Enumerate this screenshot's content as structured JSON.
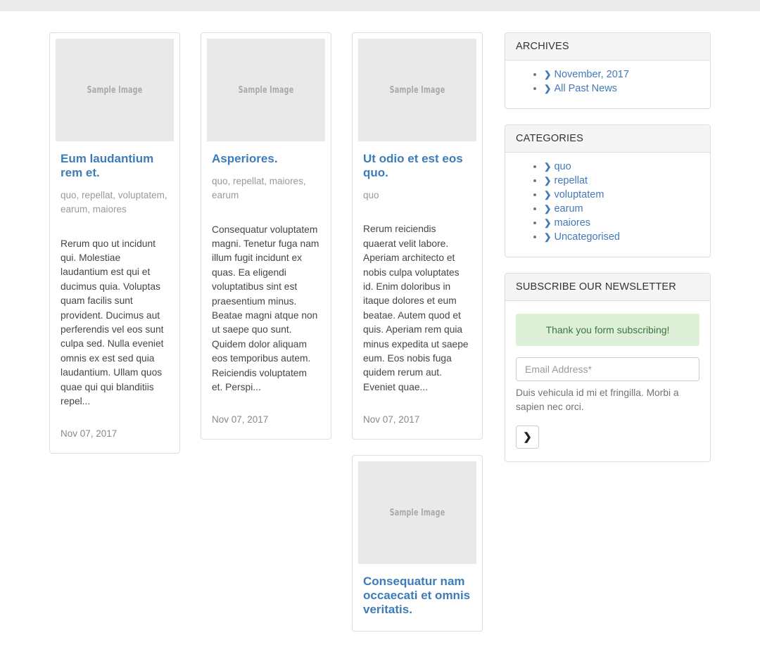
{
  "topbar": {
    "present": true
  },
  "posts": {
    "image_placeholder_label": "Sample Image",
    "columns": [
      {
        "cards": [
          {
            "title": "Eum laudantium rem et.",
            "tags": "quo, repellat, voluptatem, earum, maiores",
            "excerpt": "Rerum quo ut incidunt qui. Molestiae laudantium est qui et ducimus quia. Voluptas quam facilis sunt provident. Ducimus aut perferendis vel eos sunt culpa sed. Nulla eveniet omnis ex est sed quia laudantium. Ullam quos quae qui qui blanditiis repel...",
            "date": "Nov 07, 2017"
          }
        ]
      },
      {
        "cards": [
          {
            "title": "Asperiores.",
            "tags": "quo, repellat, maiores, earum",
            "excerpt": "Consequatur voluptatem magni. Tenetur fuga nam illum fugit incidunt ex quas. Ea eligendi voluptatibus sint est praesentium minus. Beatae magni atque non ut saepe quo sunt. Quidem dolor aliquam eos temporibus autem. Reiciendis voluptatem et. Perspi...",
            "date": "Nov 07, 2017"
          }
        ]
      },
      {
        "cards": [
          {
            "title": "Ut odio et est eos quo.",
            "tags": "quo",
            "excerpt": "Rerum reiciendis quaerat velit labore. Aperiam architecto et nobis culpa voluptates id. Enim doloribus in itaque dolores et eum beatae. Autem quod et quis. Aperiam rem quia minus expedita ut saepe eum. Eos nobis fuga quidem rerum aut. Eveniet quae...",
            "date": "Nov 07, 2017"
          },
          {
            "title": "Consequatur nam occaecati et omnis veritatis.",
            "tags": "",
            "excerpt": "",
            "date": ""
          }
        ]
      }
    ]
  },
  "sidebar": {
    "archives": {
      "heading": "ARCHIVES",
      "items": [
        {
          "label": "November, 2017"
        },
        {
          "label": "All Past News"
        }
      ]
    },
    "categories": {
      "heading": "CATEGORIES",
      "items": [
        {
          "label": "quo"
        },
        {
          "label": "repellat"
        },
        {
          "label": "voluptatem"
        },
        {
          "label": "earum"
        },
        {
          "label": "maiores"
        },
        {
          "label": "Uncategorised"
        }
      ]
    },
    "newsletter": {
      "heading": "SUBSCRIBE OUR NEWSLETTER",
      "success_message": "Thank you form subscribing!",
      "email_value": "",
      "email_placeholder": "Email Address*",
      "help_text": "Duis vehicula id mi et fringilla. Morbi a sapien nec orci.",
      "submit_glyph": "❯"
    },
    "chevron_glyph": "❯"
  },
  "colors": {
    "link": "#4279b8",
    "title": "#3c7cb8",
    "alert_bg": "#dff0d8",
    "alert_text": "#3c763d",
    "panel_head_bg": "#f5f5f5",
    "topbar": "#eaeaea",
    "image_placeholder_bg": "#e9e9e9"
  }
}
